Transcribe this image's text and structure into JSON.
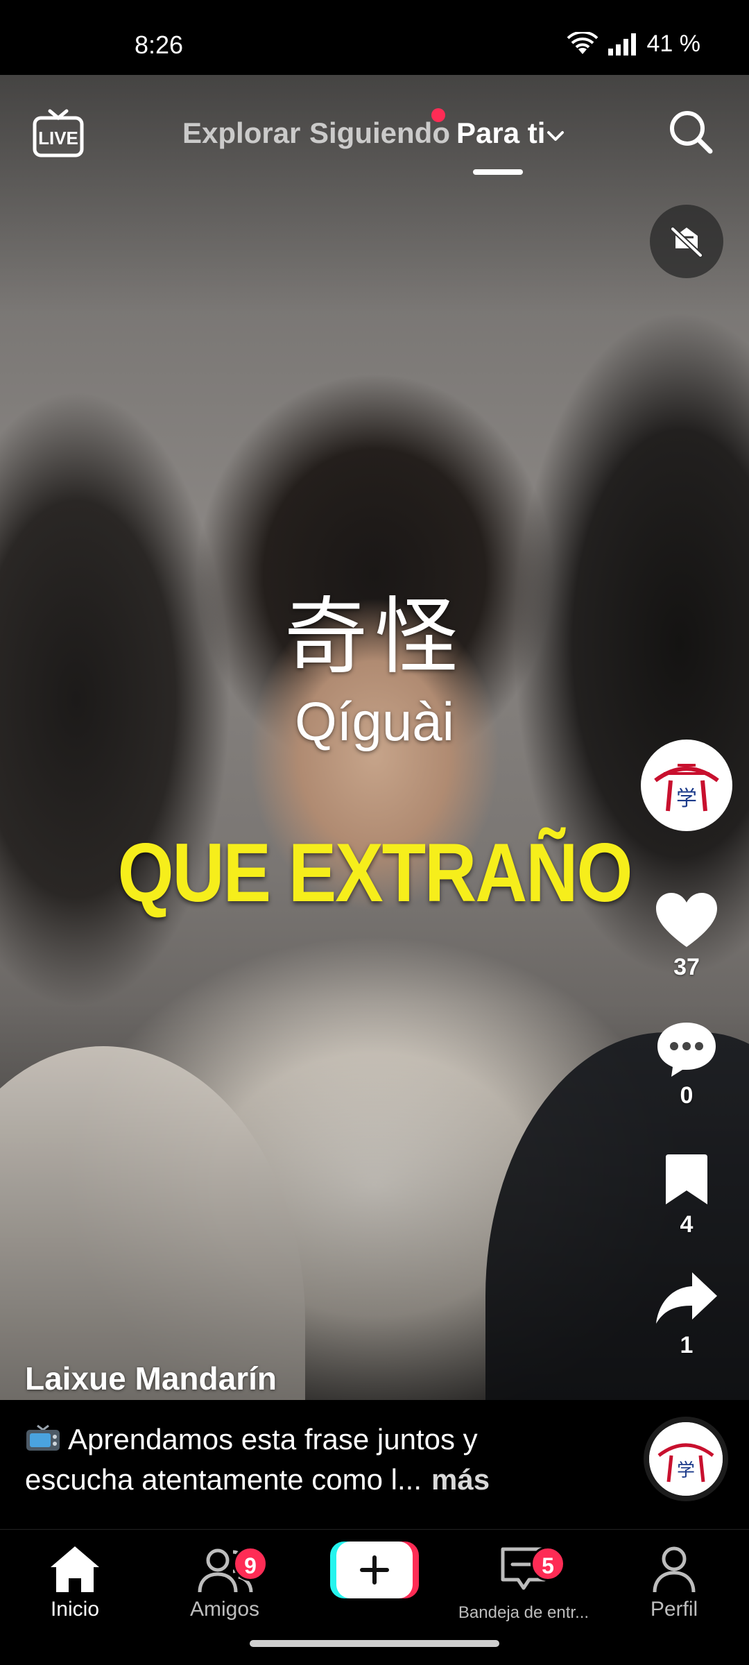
{
  "status_bar": {
    "time": "8:26",
    "battery": "41 %"
  },
  "top_nav": {
    "tabs": [
      {
        "label": "Explorar"
      },
      {
        "label": "Siguiendo"
      },
      {
        "label": "Para ti"
      }
    ],
    "active_tab": "Para ti"
  },
  "video": {
    "overlay": {
      "hanzi": "奇怪",
      "pinyin": "Qíguài",
      "translation": "QUE EXTRAÑO"
    },
    "translation_color": "#f6ee1b"
  },
  "actions": {
    "likes": "37",
    "comments": "0",
    "saves": "4",
    "shares": "1"
  },
  "post": {
    "author": "Laixue Mandarín",
    "caption": "Aprendamos esta frase juntos y escucha atentamente como l...",
    "more_label": "más"
  },
  "bottom_nav": {
    "home_label": "Inicio",
    "friends_label": "Amigos",
    "friends_badge": "9",
    "inbox_label": "Bandeja de entr...",
    "inbox_badge": "5",
    "profile_label": "Perfil"
  },
  "colors": {
    "accent_red": "#fe2c55",
    "accent_cyan": "#25f4ee"
  },
  "icons": {
    "avatar_logo_text": "学"
  }
}
